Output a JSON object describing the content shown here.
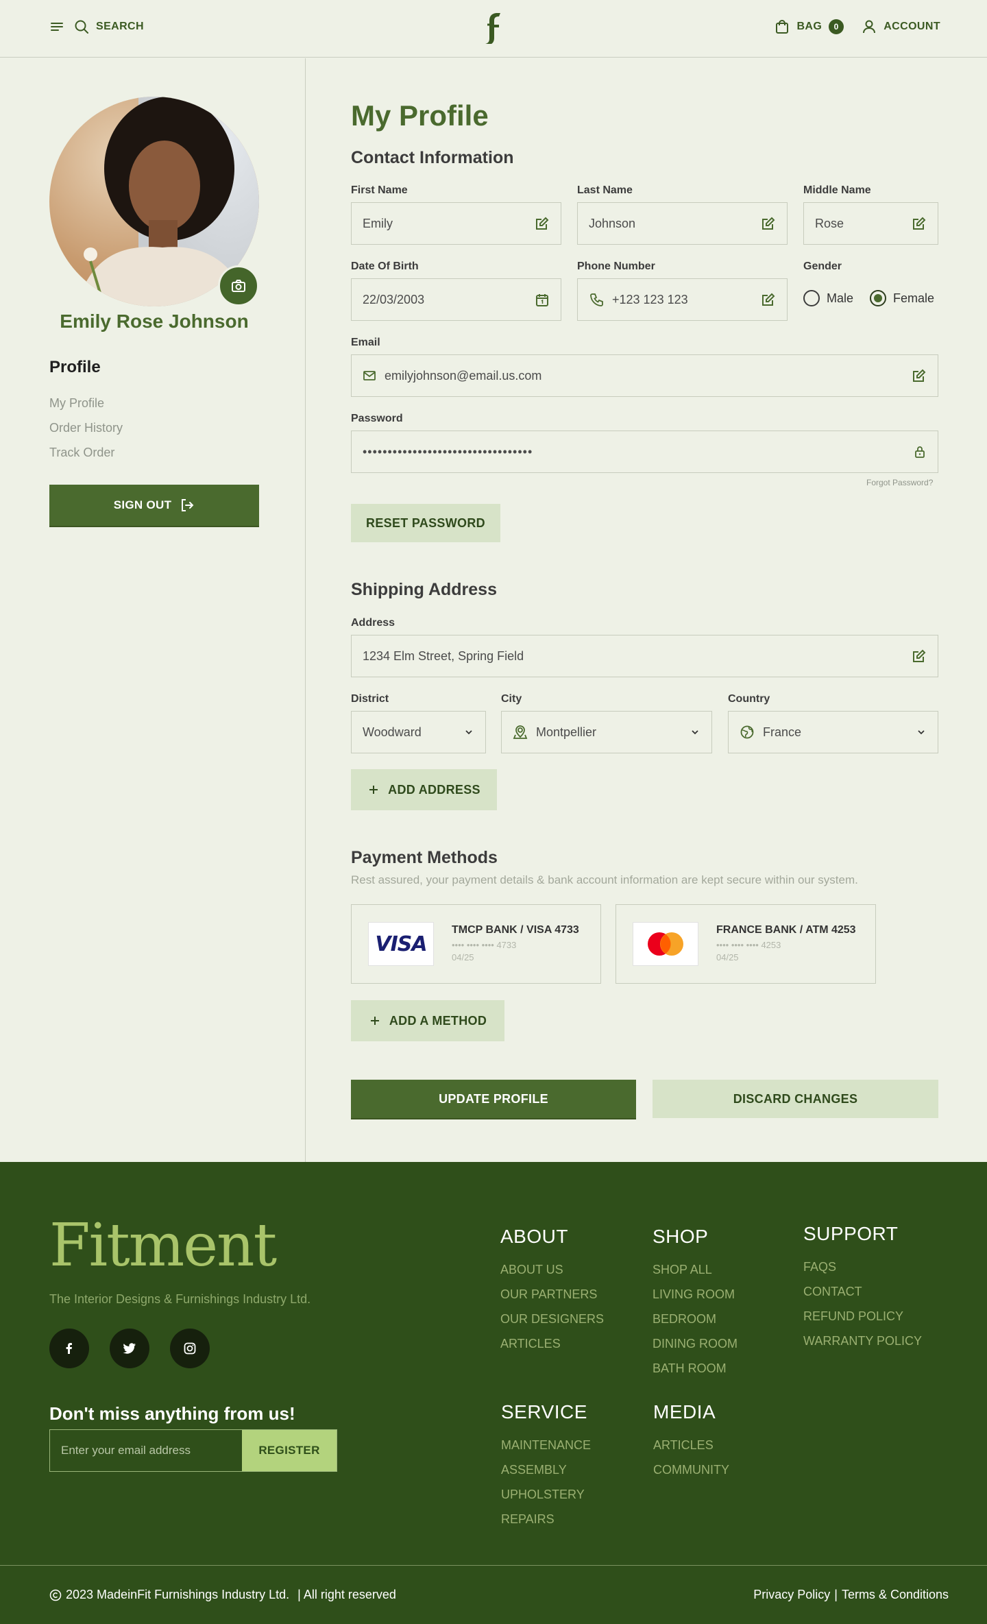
{
  "header": {
    "search_label": "SEARCH",
    "bag_label": "BAG",
    "bag_count": "0",
    "account_label": "ACCOUNT"
  },
  "sidebar": {
    "user_name": "Emily Rose Johnson",
    "heading": "Profile",
    "links": [
      "My Profile",
      "Order History",
      "Track Order"
    ],
    "signout_label": "SIGN OUT"
  },
  "profile": {
    "title": "My Profile",
    "contact_title": "Contact Information",
    "first_name": {
      "label": "First Name",
      "value": "Emily"
    },
    "last_name": {
      "label": "Last Name",
      "value": "Johnson"
    },
    "middle_name": {
      "label": "Middle Name",
      "value": "Rose"
    },
    "dob": {
      "label": "Date Of Birth",
      "value": "22/03/2003"
    },
    "phone": {
      "label": "Phone Number",
      "value": "+123 123 123"
    },
    "gender": {
      "label": "Gender",
      "options": [
        "Male",
        "Female"
      ],
      "selected": "Female"
    },
    "email": {
      "label": "Email",
      "value": "emilyjohnson@email.us.com"
    },
    "password": {
      "label": "Password",
      "value": "••••••••••••••••••••••••••••••••••"
    },
    "forgot_label": "Forgot Password?",
    "reset_label": "RESET PASSWORD"
  },
  "shipping": {
    "title": "Shipping Address",
    "address": {
      "label": "Address",
      "value": "1234 Elm Street, Spring Field"
    },
    "district": {
      "label": "District",
      "value": "Woodward"
    },
    "city": {
      "label": "City",
      "value": "Montpellier"
    },
    "country": {
      "label": "Country",
      "value": "France"
    },
    "add_label": "ADD ADDRESS"
  },
  "payment": {
    "title": "Payment Methods",
    "subtitle": "Rest assured, your payment details & bank account information are kept secure within our system.",
    "cards": [
      {
        "brand": "visa",
        "logo_text": "VISA",
        "title": "TMCP BANK / VISA 4733",
        "number": "•••• •••• •••• 4733",
        "expiry": "04/25"
      },
      {
        "brand": "mastercard",
        "title": "FRANCE BANK / ATM 4253",
        "number": "•••• •••• •••• 4253",
        "expiry": "04/25"
      }
    ],
    "add_label": "ADD A METHOD"
  },
  "actions": {
    "update_label": "UPDATE PROFILE",
    "discard_label": "DISCARD CHANGES"
  },
  "footer": {
    "brand": "Fitment",
    "tagline": "The Interior Designs & Furnishings Industry Ltd.",
    "newsletter_title": "Don't miss anything from us!",
    "email_placeholder": "Enter your email address",
    "register_label": "REGISTER",
    "columns": [
      {
        "title": "ABOUT",
        "links": [
          "ABOUT US",
          "OUR PARTNERS",
          "OUR DESIGNERS",
          "ARTICLES"
        ]
      },
      {
        "title": "SHOP",
        "links": [
          "SHOP ALL",
          "LIVING ROOM",
          "BEDROOM",
          "DINING ROOM",
          "BATH ROOM"
        ]
      },
      {
        "title": "SUPPORT",
        "links": [
          "FAQS",
          "CONTACT",
          "REFUND POLICY",
          "WARRANTY POLICY"
        ]
      },
      {
        "title": "SERVICE",
        "links": [
          "MAINTENANCE",
          "ASSEMBLY",
          "UPHOLSTERY",
          "REPAIRS"
        ]
      },
      {
        "title": "MEDIA",
        "links": [
          "ARTICLES",
          "COMMUNITY"
        ]
      }
    ],
    "copyright": "2023 MadeinFit Furnishings Industry Ltd.",
    "rights": "| All right reserved",
    "privacy": "Privacy Policy",
    "separator": "|",
    "terms": "Terms & Conditions"
  },
  "colors": {
    "brand_green": "#4a6a2e",
    "footer_green": "#2f4f1a",
    "light_green": "#d7e3c8",
    "background": "#eef1e6"
  }
}
